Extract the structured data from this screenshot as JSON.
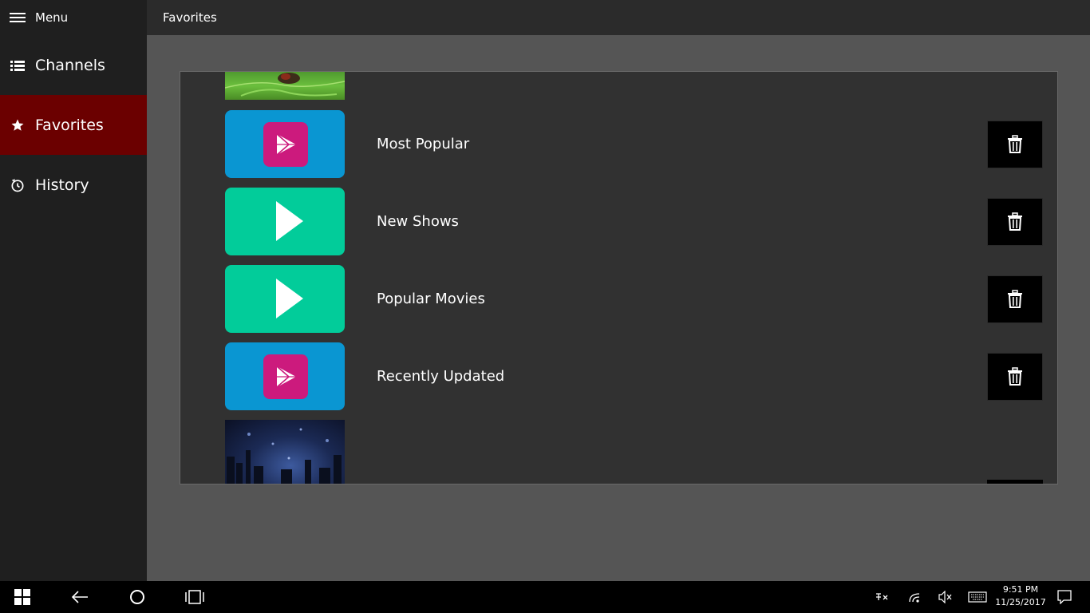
{
  "sidebar": {
    "menu_label": "Menu",
    "items": [
      {
        "label": "Channels",
        "icon": "list-icon"
      },
      {
        "label": "Favorites",
        "icon": "star-icon"
      },
      {
        "label": "History",
        "icon": "history-icon"
      }
    ],
    "active_color": "#6b0000"
  },
  "header": {
    "title": "Favorites"
  },
  "favorites": {
    "rows": [
      {
        "label": "Most Popular",
        "thumb": "blue-play-app"
      },
      {
        "label": "New Shows",
        "thumb": "green-play"
      },
      {
        "label": "Popular Movies",
        "thumb": "green-play"
      },
      {
        "label": "Recently Updated",
        "thumb": "blue-play-app"
      }
    ]
  },
  "taskbar": {
    "time": "9:51 PM",
    "date": "11/25/2017"
  },
  "colors": {
    "thumb_blue": "#0a96d2",
    "thumb_green": "#02cc9a",
    "play_app_pink": "#cc1a7d"
  }
}
